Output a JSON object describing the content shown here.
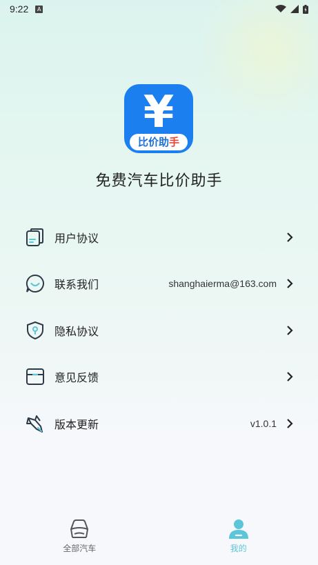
{
  "status_bar": {
    "time": "9:22",
    "notification_icon": "a-notification-icon",
    "right_icons": [
      "wifi-icon",
      "signal-icon",
      "battery-icon"
    ]
  },
  "app": {
    "title": "免费汽车比价助手",
    "logo_symbol": "¥",
    "logo_banner_part1": "比价助",
    "logo_banner_part2": "手"
  },
  "menu": {
    "items": [
      {
        "label": "用户协议",
        "value": "",
        "icon": "document-icon"
      },
      {
        "label": "联系我们",
        "value": "shanghaierma@163.com",
        "icon": "chat-icon"
      },
      {
        "label": "隐私协议",
        "value": "",
        "icon": "shield-icon"
      },
      {
        "label": "意见反馈",
        "value": "",
        "icon": "feedback-box-icon"
      },
      {
        "label": "版本更新",
        "value": "v1.0.1",
        "icon": "rocket-icon"
      }
    ]
  },
  "tabs": [
    {
      "label": "全部汽车",
      "icon": "car-icon",
      "active": false
    },
    {
      "label": "我的",
      "icon": "user-icon",
      "active": true
    }
  ],
  "colors": {
    "brand_blue": "#1b7ff0",
    "active_tab": "#5bc6d8",
    "icon_stroke": "#2b3a46",
    "icon_accent": "#5bc6d8"
  }
}
